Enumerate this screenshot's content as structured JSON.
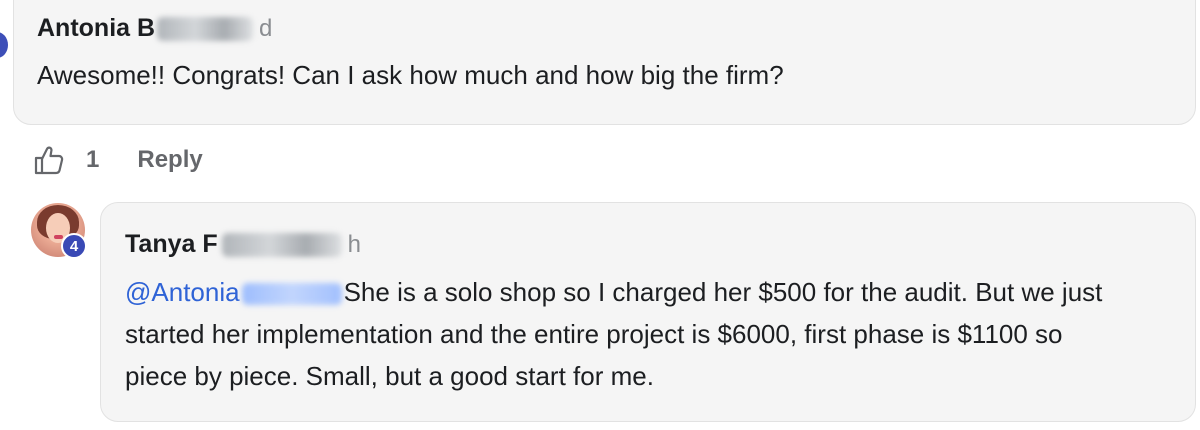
{
  "comment_1": {
    "author_visible": "Antonia B",
    "timestamp": "d",
    "text": "Awesome!! Congrats! Can I ask how much and how big the firm?",
    "like_count": "1",
    "reply_label": "Reply"
  },
  "comment_2": {
    "author_visible": "Tanya F",
    "timestamp": "h",
    "badge": "4",
    "mention": "@Antonia",
    "text_line_1": "She is a solo shop so I charged her $500 for the audit. But we just",
    "text_line_2": "started her implementation and the entire project is $6000, first phase is $1100 so",
    "text_line_3": "piece by piece. Small, but a good start for me."
  },
  "colors": {
    "bubble_bg": "#f5f5f5",
    "mention": "#2f63d6",
    "secondary_text": "#65676b",
    "badge": "#3949b5"
  },
  "icons": {
    "like": "thumbs-up-outline-icon"
  }
}
